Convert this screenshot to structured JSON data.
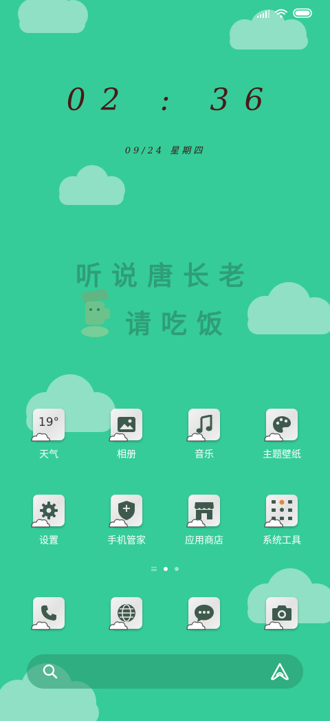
{
  "lockscreen": {
    "time": "02 : 36",
    "date": "09/24  星期四"
  },
  "wallpaper": {
    "line1": "听说唐长老",
    "line2": "请吃饭"
  },
  "apps_row1": [
    {
      "label": "天气",
      "icon": "weather-icon",
      "icon_text": "19°"
    },
    {
      "label": "相册",
      "icon": "gallery-icon"
    },
    {
      "label": "音乐",
      "icon": "music-icon"
    },
    {
      "label": "主题壁纸",
      "icon": "palette-icon"
    }
  ],
  "apps_row2": [
    {
      "label": "设置",
      "icon": "gear-icon"
    },
    {
      "label": "手机管家",
      "icon": "shield-plus-icon",
      "icon_text": "+"
    },
    {
      "label": "应用商店",
      "icon": "store-icon"
    },
    {
      "label": "系统工具",
      "icon": "tools-grid-icon"
    }
  ],
  "dock": [
    {
      "icon": "phone-icon"
    },
    {
      "icon": "browser-icon"
    },
    {
      "icon": "messages-icon"
    },
    {
      "icon": "camera-icon"
    }
  ],
  "pager": {
    "pages": 2,
    "current": 1
  },
  "search_bar": {
    "left_icon": "search-icon",
    "right_icon": "assistant-icon"
  },
  "colors": {
    "background": "#35cc99",
    "cloud": "#8fe0c4",
    "clock": "#4a1818",
    "icon_glyph": "#3e5a4c"
  }
}
